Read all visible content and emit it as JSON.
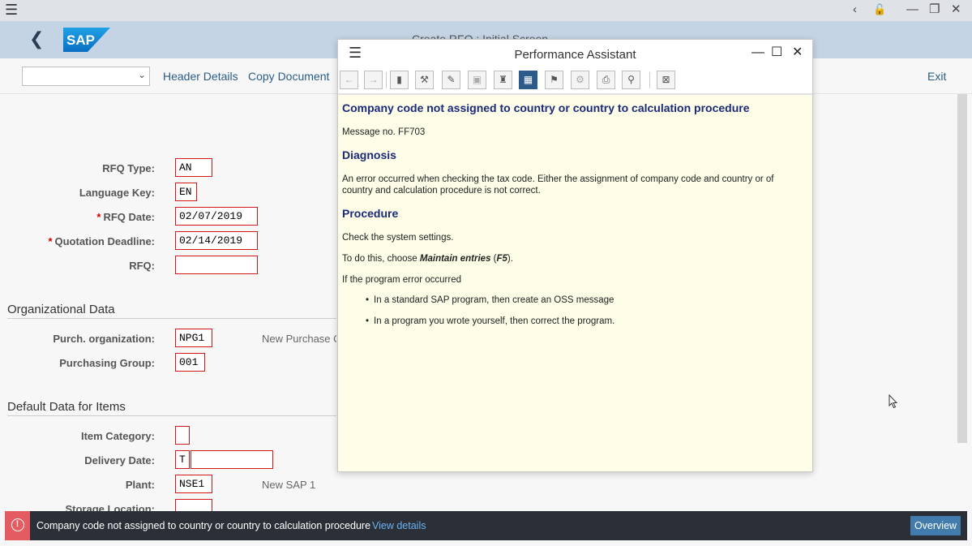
{
  "window": {
    "controls": {
      "back": "‹",
      "lock": "🔓",
      "minimize": "—",
      "restore": "❐",
      "close": "✕"
    }
  },
  "shell": {
    "logo_text": "SAP",
    "title": "Create RFQ : Initial Screen"
  },
  "toolbar": {
    "dropdown_value": "",
    "header_details": "Header Details",
    "copy_document": "Copy Document",
    "exit": "Exit"
  },
  "form": {
    "rfq_type": {
      "label": "RFQ Type:",
      "value": "AN"
    },
    "language_key": {
      "label": "Language Key:",
      "value": "EN"
    },
    "rfq_date": {
      "label": "RFQ Date:",
      "value": "02/07/2019",
      "required": "*"
    },
    "quotation_deadline": {
      "label": "Quotation Deadline:",
      "value": "02/14/2019",
      "required": "*"
    },
    "rfq": {
      "label": "RFQ:",
      "value": ""
    },
    "org_section": "Organizational Data",
    "purch_org": {
      "label": "Purch. organization:",
      "value": "NPG1",
      "desc": "New Purchase Org"
    },
    "purch_group": {
      "label": "Purchasing Group:",
      "value": "001"
    },
    "default_section": "Default Data for Items",
    "item_category": {
      "label": "Item Category:",
      "value": ""
    },
    "delivery_date": {
      "label": "Delivery Date:",
      "value": "T",
      "value2": ""
    },
    "plant": {
      "label": "Plant:",
      "value": "NSE1",
      "desc": "New SAP 1"
    },
    "storage_location": {
      "label": "Storage Location:",
      "value": ""
    }
  },
  "assistant": {
    "title": "Performance Assistant",
    "heading": "Company code not assigned to country or country to calculation procedure",
    "message_no": "Message no. FF703",
    "diagnosis_title": "Diagnosis",
    "diagnosis_text": "An error occurred when checking the tax code. Either the assignment of company code and country or of country and calculation procedure is not correct.",
    "procedure_title": "Procedure",
    "procedure_check": "Check the system settings.",
    "procedure_do_prefix": "To do this, choose ",
    "procedure_do_bold": "Maintain entries",
    "procedure_do_paren_open": " (",
    "procedure_do_key": "F5",
    "procedure_do_suffix": ").",
    "procedure_if": "If the program error occurred",
    "bullets": [
      "In a standard SAP program, then create an OSS message",
      "In a program you wrote yourself, then correct the program."
    ]
  },
  "status": {
    "message": "Company code not assigned to country or country to calculation procedure",
    "view_details": "View details",
    "overview": "Overview"
  }
}
